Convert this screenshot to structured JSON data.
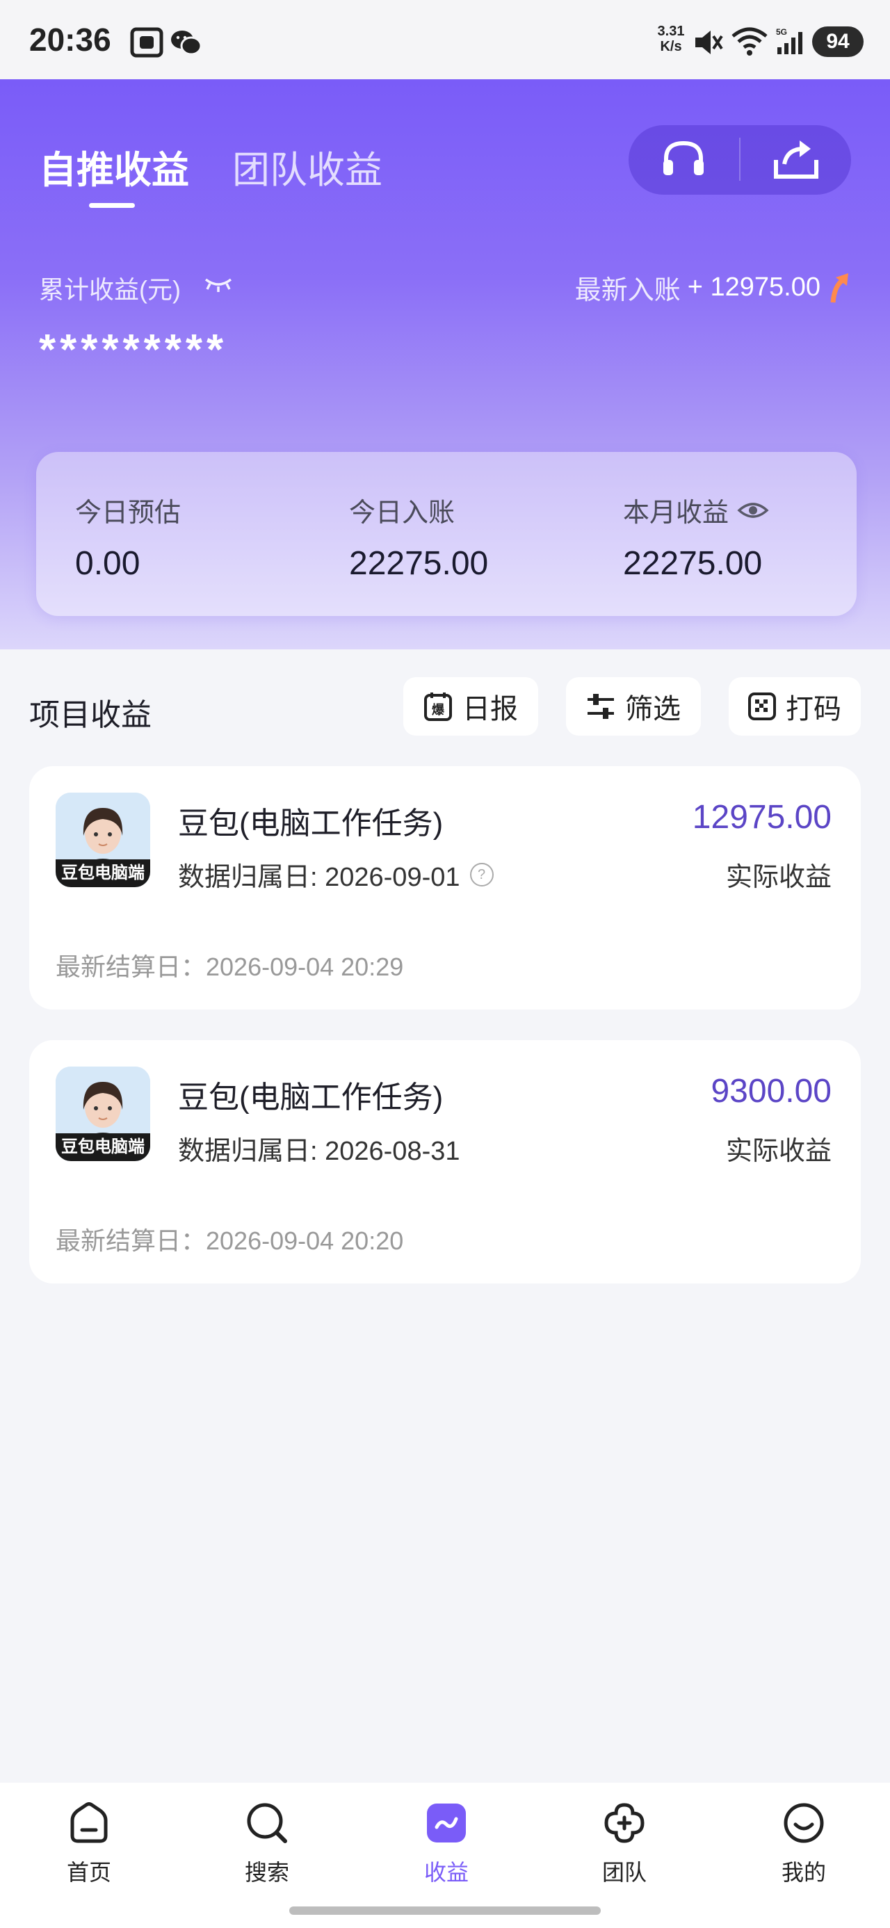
{
  "status_bar": {
    "time": "20:36",
    "net_speed": "3.31\nK/s",
    "net_speed_value": "3.31",
    "net_speed_unit": "K/s",
    "battery": "94",
    "icons": [
      "screen-record-icon",
      "wechat-icon",
      "mute-icon",
      "wifi-icon",
      "signal-5g-icon"
    ]
  },
  "header": {
    "tabs": [
      {
        "label": "自推收益",
        "active": true
      },
      {
        "label": "团队收益",
        "active": false
      }
    ],
    "actions": [
      "headset-icon",
      "share-icon"
    ],
    "cumulative_label": "累计收益(元)",
    "masked_total": "*********",
    "latest_label": "最新入账",
    "latest_value": "+ 12975.00"
  },
  "summary": {
    "items": [
      {
        "label": "今日预估",
        "value": "0.00"
      },
      {
        "label": "今日入账",
        "value": "22275.00"
      },
      {
        "label": "本月收益",
        "value": "22275.00"
      }
    ]
  },
  "section": {
    "title": "项目收益",
    "chips": [
      {
        "label": "日报",
        "icon": "calendar-hot-icon"
      },
      {
        "label": "筛选",
        "icon": "filter-icon"
      },
      {
        "label": "打码",
        "icon": "mosaic-icon"
      }
    ]
  },
  "items": [
    {
      "avatar_label": "豆包电脑端",
      "name": "豆包(电脑工作任务)",
      "date": "数据归属日: 2026-09-01",
      "amount": "12975.00",
      "amount_label": "实际收益",
      "settle": "最新结算日：2026-09-04 20:29"
    },
    {
      "avatar_label": "豆包电脑端",
      "name": "豆包(电脑工作任务)",
      "date": "数据归属日: 2026-08-31",
      "amount": "9300.00",
      "amount_label": "实际收益",
      "settle": "最新结算日：2026-09-04 20:20"
    }
  ],
  "bottom_nav": [
    {
      "label": "首页",
      "icon": "home-icon",
      "active": false
    },
    {
      "label": "搜索",
      "icon": "search-icon",
      "active": false
    },
    {
      "label": "收益",
      "icon": "earnings-icon",
      "active": true
    },
    {
      "label": "团队",
      "icon": "team-icon",
      "active": false
    },
    {
      "label": "我的",
      "icon": "profile-icon",
      "active": false
    }
  ],
  "colors": {
    "accent": "#7a5cf8",
    "amount": "#5b45c6"
  }
}
